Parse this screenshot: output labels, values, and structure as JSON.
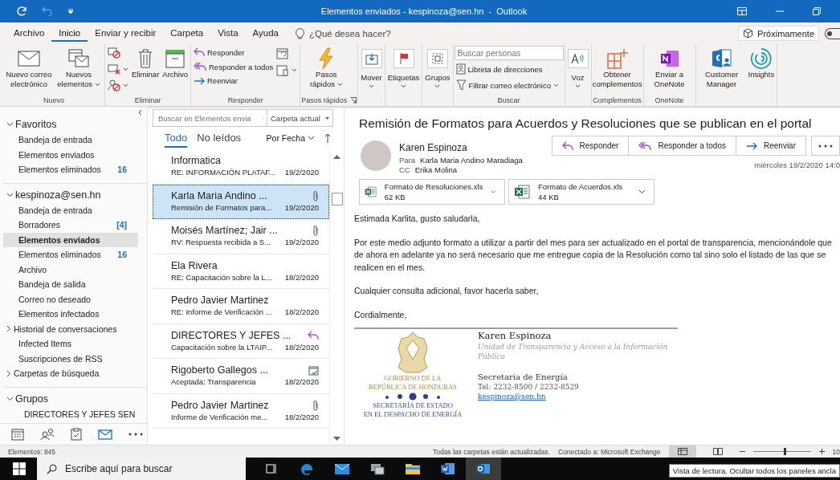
{
  "title_bar": {
    "title": "Elementos enviados - kespinoza@sen.hn  -  Outlook"
  },
  "menu_tabs": [
    {
      "label": "Archivo",
      "selected": false
    },
    {
      "label": "Inicio",
      "selected": true
    },
    {
      "label": "Enviar y recibir",
      "selected": false
    },
    {
      "label": "Carpeta",
      "selected": false
    },
    {
      "label": "Vista",
      "selected": false
    },
    {
      "label": "Ayuda",
      "selected": false
    }
  ],
  "tell_me": {
    "placeholder": "¿Qué desea hacer?"
  },
  "coming_soon": {
    "label": "Próximamente",
    "on": false
  },
  "ribbon": {
    "groups": [
      {
        "label": "Nuevo",
        "launcher": false,
        "columns": [
          [
            {
              "kind": "large",
              "label": "Nuevo correo electrónico",
              "dropdown": false
            }
          ],
          [
            {
              "kind": "large",
              "label": "Nuevos elementos",
              "dropdown": true
            }
          ]
        ]
      },
      {
        "label": "Eliminar",
        "launcher": false,
        "columns": [
          [
            {
              "kind": "icon",
              "dropdown": false
            },
            {
              "kind": "icon",
              "dropdown": true
            },
            {
              "kind": "icon",
              "dropdown": true
            }
          ],
          [
            {
              "kind": "large",
              "label": "Eliminar",
              "dropdown": false
            }
          ],
          [
            {
              "kind": "large",
              "label": "Archivo",
              "dropdown": false
            }
          ]
        ]
      },
      {
        "label": "Responder",
        "launcher": false,
        "columns": [
          [
            {
              "kind": "small",
              "label": "Responder",
              "dropdown": false
            },
            {
              "kind": "small",
              "label": "Responder a todos",
              "dropdown": false
            },
            {
              "kind": "small",
              "label": "Reenviar",
              "dropdown": false
            }
          ],
          [
            {
              "kind": "icon",
              "dropdown": false
            },
            {
              "kind": "icon",
              "dropdown": true
            }
          ]
        ]
      },
      {
        "label": "Pasos rápidos",
        "launcher": true,
        "columns": [
          [
            {
              "kind": "large",
              "label": "Pasos rápidos",
              "dropdown": true
            }
          ]
        ]
      },
      {
        "columns": [
          [
            {
              "kind": "boxed",
              "label": "Mover",
              "dropdown": true
            }
          ]
        ]
      },
      {
        "columns": [
          [
            {
              "kind": "boxed",
              "label": "Etiquetas",
              "dropdown": true
            }
          ]
        ]
      },
      {
        "columns": [
          [
            {
              "kind": "boxed",
              "label": "Grupos",
              "dropdown": true
            }
          ]
        ]
      },
      {
        "label": "Buscar",
        "launcher": false,
        "columns": [
          [
            {
              "kind": "field",
              "placeholder": "Buscar personas"
            },
            {
              "kind": "small",
              "label": "Libreta de direcciones",
              "dropdown": false
            },
            {
              "kind": "small",
              "label": "Filtrar correo electrónico",
              "dropdown": true
            }
          ]
        ]
      },
      {
        "columns": [
          [
            {
              "kind": "boxed",
              "label": "Voz",
              "dropdown": true
            }
          ]
        ]
      },
      {
        "label": "Complementos",
        "launcher": false,
        "columns": [
          [
            {
              "kind": "large",
              "label": "Obtener complementos",
              "dropdown": false
            }
          ]
        ]
      },
      {
        "label": "OneNote",
        "launcher": false,
        "columns": [
          [
            {
              "kind": "large",
              "label": "Enviar a OneNote",
              "dropdown": false
            }
          ]
        ]
      },
      {
        "columns": [
          [
            {
              "kind": "large",
              "label": "Customer Manager",
              "dropdown": false
            }
          ],
          [
            {
              "kind": "large",
              "label": "Insights",
              "dropdown": false
            }
          ]
        ]
      }
    ]
  },
  "folder_pane": {
    "sections": [
      {
        "title": "Favoritos",
        "expanded": true,
        "items": [
          {
            "label": "Bandeja de entrada",
            "kind": "folder",
            "selected": false
          },
          {
            "label": "Elementos enviados",
            "kind": "folder",
            "selected": false
          },
          {
            "label": "Elementos eliminados",
            "count": "16",
            "kind": "folder",
            "selected": false
          }
        ]
      },
      {
        "title": "kespinoza@sen.hn",
        "expanded": true,
        "items": [
          {
            "label": "Bandeja de entrada",
            "kind": "folder",
            "selected": false
          },
          {
            "label": "Borradores",
            "count": "[4]",
            "kind": "folder",
            "selected": false
          },
          {
            "label": "Elementos enviados",
            "kind": "folder",
            "selected": true
          },
          {
            "label": "Elementos eliminados",
            "count": "16",
            "kind": "folder",
            "selected": false
          },
          {
            "label": "Archivo",
            "kind": "folder",
            "selected": false
          },
          {
            "label": "Bandeja de salida",
            "kind": "folder",
            "selected": false
          },
          {
            "label": "Correo no deseado",
            "kind": "folder",
            "selected": false
          },
          {
            "label": "Elementos infectados",
            "kind": "folder",
            "selected": false
          },
          {
            "label": "Historial de conversaciones",
            "kind": "parent",
            "selected": false
          },
          {
            "label": "Infected Items",
            "kind": "folder",
            "selected": false
          },
          {
            "label": "Suscripciones de RSS",
            "kind": "folder",
            "selected": false
          },
          {
            "label": "Carpetas de búsqueda",
            "kind": "parent",
            "selected": false
          }
        ]
      },
      {
        "title": "Grupos",
        "expanded": true,
        "items": [
          {
            "label": "DIRECTORES Y JEFES SEN",
            "kind": "group",
            "selected": false
          }
        ]
      }
    ],
    "nav": [
      {
        "selected": false
      },
      {
        "selected": false
      },
      {
        "selected": false
      },
      {
        "selected": true
      },
      {
        "selected": false
      }
    ]
  },
  "message_list": {
    "search": {
      "placeholder": "Buscar en Elementos envia"
    },
    "scope": "Carpeta actual",
    "filters": [
      {
        "label": "Todo",
        "selected": true
      },
      {
        "label": "No leídos",
        "selected": false
      }
    ],
    "sort": "Por Fecha",
    "messages": [
      {
        "sender": "Informatica",
        "subject": "RE: INFORMACIÓN PLATAF...",
        "date": "19/2/2020",
        "attachment": false,
        "replied": false,
        "accepted": false,
        "selected": false
      },
      {
        "sender": "Karla Maria Andino ...",
        "subject": "Remisión de Formatos para...",
        "date": "19/2/2020",
        "attachment": true,
        "replied": false,
        "accepted": false,
        "selected": true
      },
      {
        "sender": "Moisés Martínez; Jair ...",
        "subject": "RV: Respuesta recibida a  S...",
        "date": "19/2/2020",
        "attachment": true,
        "replied": false,
        "accepted": false,
        "selected": false
      },
      {
        "sender": "Ela Rivera",
        "subject": "RE: Capacitación sobre la L...",
        "date": "18/2/2020",
        "attachment": false,
        "replied": false,
        "accepted": false,
        "selected": false
      },
      {
        "sender": "Pedro Javier Martinez",
        "subject": "RE: Informe de Verificación ...",
        "date": "18/2/2020",
        "attachment": false,
        "replied": false,
        "accepted": false,
        "selected": false
      },
      {
        "sender": "DIRECTORES Y JEFES ...",
        "subject": "Capacitación sobre la LTAIP...",
        "date": "18/2/2020",
        "attachment": false,
        "replied": true,
        "accepted": false,
        "selected": false
      },
      {
        "sender": "Rigoberto Gallegos ...",
        "subject": "Aceptada: Transparencia",
        "date": "18/2/2020",
        "attachment": false,
        "replied": false,
        "accepted": true,
        "selected": false
      },
      {
        "sender": "Pedro Javier Martinez",
        "subject": "Informe de Verificación me...",
        "date": "18/2/2020",
        "attachment": true,
        "replied": false,
        "accepted": false,
        "selected": false
      }
    ]
  },
  "reading_pane": {
    "subject": "Remisión de Formatos para Acuerdos y Resoluciones que se publican en el portal",
    "sender": "Karen Espinoza",
    "to_label": "Para",
    "to": "Karla Maria Andino Maradiaga",
    "cc_label": "CC",
    "cc": "Erika Molina",
    "actions": [
      {
        "label": "Responder"
      },
      {
        "label": "Responder a todos"
      },
      {
        "label": "Reenviar"
      }
    ],
    "date": "miércoles 19/2/2020 14:0",
    "attachments": [
      {
        "name": "Formato de Resoluciones.xls",
        "size": "62 KB"
      },
      {
        "name": "Formato de Acuerdos.xls",
        "size": "44 KB"
      }
    ],
    "body": [
      "Estimada Karlita, gusto saludarla,",
      "Por este medio adjunto formato a utilizar a partir del mes para ser actualizado en el portal de transparencia, mencionándole que de ahora en adelante ya no será necesario que me entregue copia de la Resolución como tal sino solo el listado de las que se realicen en el mes.",
      "Cualquier consulta adicional, favor hacerla saber,",
      "Cordialmente,"
    ],
    "signature": {
      "logo_top": [
        "GOBIERNO DE LA",
        "REPÚBLICA DE HONDURAS"
      ],
      "logo_bottom": [
        "SECRETARÍA DE ESTADO",
        "EN EL DESPACHO DE ENERGÍA"
      ],
      "name": "Karen Espinoza",
      "unit": "Unidad de Transparencia y Acceso a la Información Pública",
      "org": "Secretaría de Energía",
      "tel": "Tel: 2232-8500 / 2232-8529",
      "email": "kespinoza@sen.hn"
    }
  },
  "status_bar": {
    "items": "Elementos: 845",
    "sync": "Todas las carpetas están actualizadas.",
    "connection": "Conectado a: Microsoft Exchange",
    "views": [
      {
        "selected": true
      },
      {
        "selected": false
      }
    ],
    "zoom": {
      "level": 0.55,
      "reading": "10"
    }
  },
  "taskbar": {
    "search": {
      "placeholder": "Escribe aquí para buscar"
    },
    "apps": [
      {
        "selected": false
      },
      {
        "selected": false
      },
      {
        "selected": false
      },
      {
        "selected": false
      },
      {
        "selected": false
      },
      {
        "selected": false
      },
      {
        "selected": true
      }
    ]
  },
  "tooltip": "Vista de lectura. Ocultar todos los paneles ancla"
}
